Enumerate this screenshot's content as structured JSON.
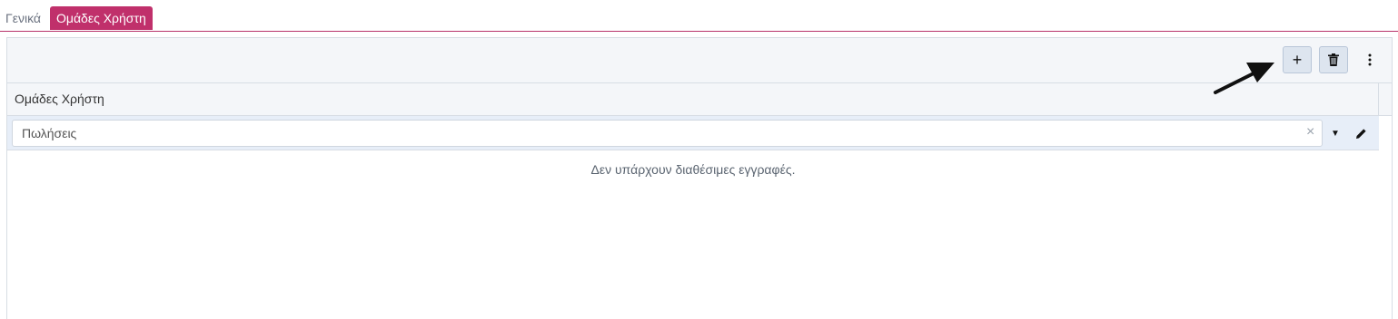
{
  "tabs": [
    {
      "label": "Γενικά"
    },
    {
      "label": "Ομάδες Χρήστη"
    }
  ],
  "toolbar": {
    "add_label": "+",
    "add_icon": "plus-icon",
    "delete_icon": "trash-icon",
    "more_icon": "kebab-menu-icon"
  },
  "grid": {
    "column_header": "Ομάδες Χρήστη",
    "filter_value": "Πωλήσεις",
    "clear_label": "×",
    "dropdown_label": "▼",
    "empty_message": "Δεν υπάρχουν διαθέσιμες εγγραφές."
  },
  "colors": {
    "accent": "#c0306b",
    "button_bg": "#dde5ef",
    "header_bg": "#f4f6f9",
    "filter_row_bg": "#e7eef8"
  }
}
